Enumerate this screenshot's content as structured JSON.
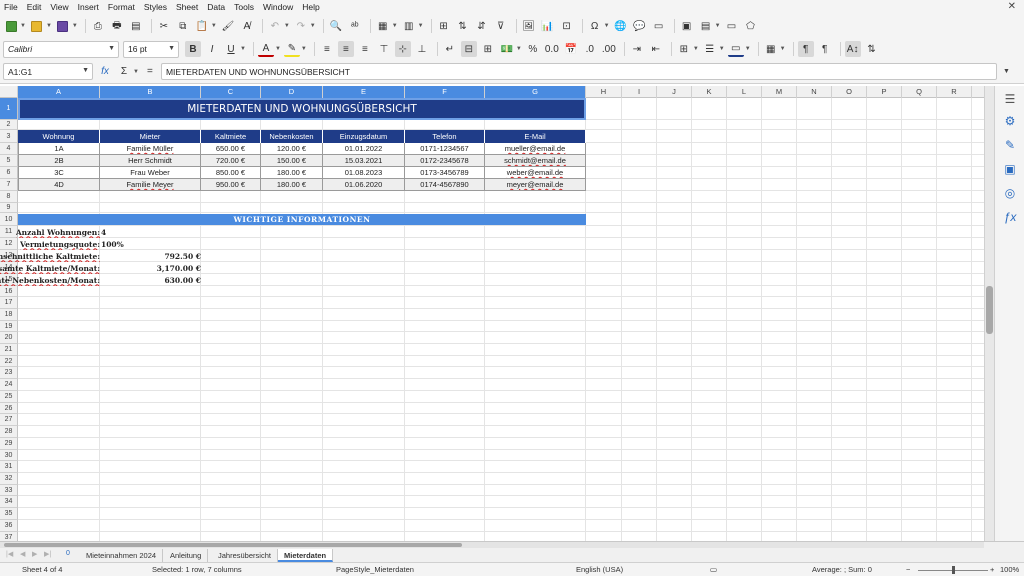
{
  "menu": [
    "File",
    "Edit",
    "View",
    "Insert",
    "Format",
    "Styles",
    "Sheet",
    "Data",
    "Tools",
    "Window",
    "Help"
  ],
  "font": {
    "name": "Calibri",
    "size": "16 pt"
  },
  "formula": {
    "cell_ref": "A1:G1",
    "content": "MIETERDATEN UND WOHNUNGSÜBERSICHT"
  },
  "columns": [
    "A",
    "B",
    "C",
    "D",
    "E",
    "F",
    "G",
    "H",
    "I",
    "J",
    "K",
    "L",
    "M",
    "N",
    "O",
    "P",
    "Q",
    "R"
  ],
  "rows": [
    "1",
    "2",
    "3",
    "4",
    "5",
    "6",
    "7",
    "8",
    "9",
    "10",
    "11",
    "12",
    "13",
    "14",
    "15",
    "16",
    "17",
    "18",
    "19",
    "20",
    "21",
    "22",
    "23",
    "24",
    "25",
    "26",
    "27",
    "28",
    "29",
    "30",
    "31",
    "32",
    "33",
    "34",
    "35",
    "36",
    "37",
    "38"
  ],
  "sheet": {
    "title": "MIETERDATEN UND WOHNUNGSÜBERSICHT",
    "headers": [
      "Wohnung",
      "Mieter",
      "Kaltmiete",
      "Nebenkosten",
      "Einzugsdatum",
      "Telefon",
      "E-Mail"
    ],
    "data_rows": [
      [
        "1A",
        "Familie Müller",
        "650.00 €",
        "120.00 €",
        "01.01.2022",
        "0171-1234567",
        "mueller@email.de"
      ],
      [
        "2B",
        "Herr Schmidt",
        "720.00 €",
        "150.00 €",
        "15.03.2021",
        "0172-2345678",
        "schmidt@email.de"
      ],
      [
        "3C",
        "Frau Weber",
        "850.00 €",
        "180.00 €",
        "01.08.2023",
        "0173-3456789",
        "weber@email.de"
      ],
      [
        "4D",
        "Familie Meyer",
        "950.00 €",
        "180.00 €",
        "01.06.2020",
        "0174-4567890",
        "meyer@email.de"
      ]
    ],
    "info_title": "WICHTIGE INFORMATIONEN",
    "info": [
      {
        "label": "Anzahl Wohnungen:",
        "value": "4"
      },
      {
        "label": "Vermietungsquote:",
        "value": "100%"
      },
      {
        "label": "Durchschnittliche Kaltmiete:",
        "value": "792.50 €"
      },
      {
        "label": "Gesamte Kaltmiete/Monat:",
        "value": "3,170.00 €"
      },
      {
        "label": "Gesamte Nebenkosten/Monat:",
        "value": "630.00 €"
      }
    ]
  },
  "tabs": [
    "Mieteinnahmen 2024",
    "Anleitung",
    "Jahresübersicht",
    "Mieterdaten"
  ],
  "tab_nav_label": "0",
  "status": {
    "sheet": "Sheet 4 of 4",
    "selection": "Selected: 1 row, 7 columns",
    "page_style": "PageStyle_Mieterdaten",
    "language": "English (USA)",
    "summary": "Average: ; Sum: 0",
    "zoom": "100%"
  }
}
